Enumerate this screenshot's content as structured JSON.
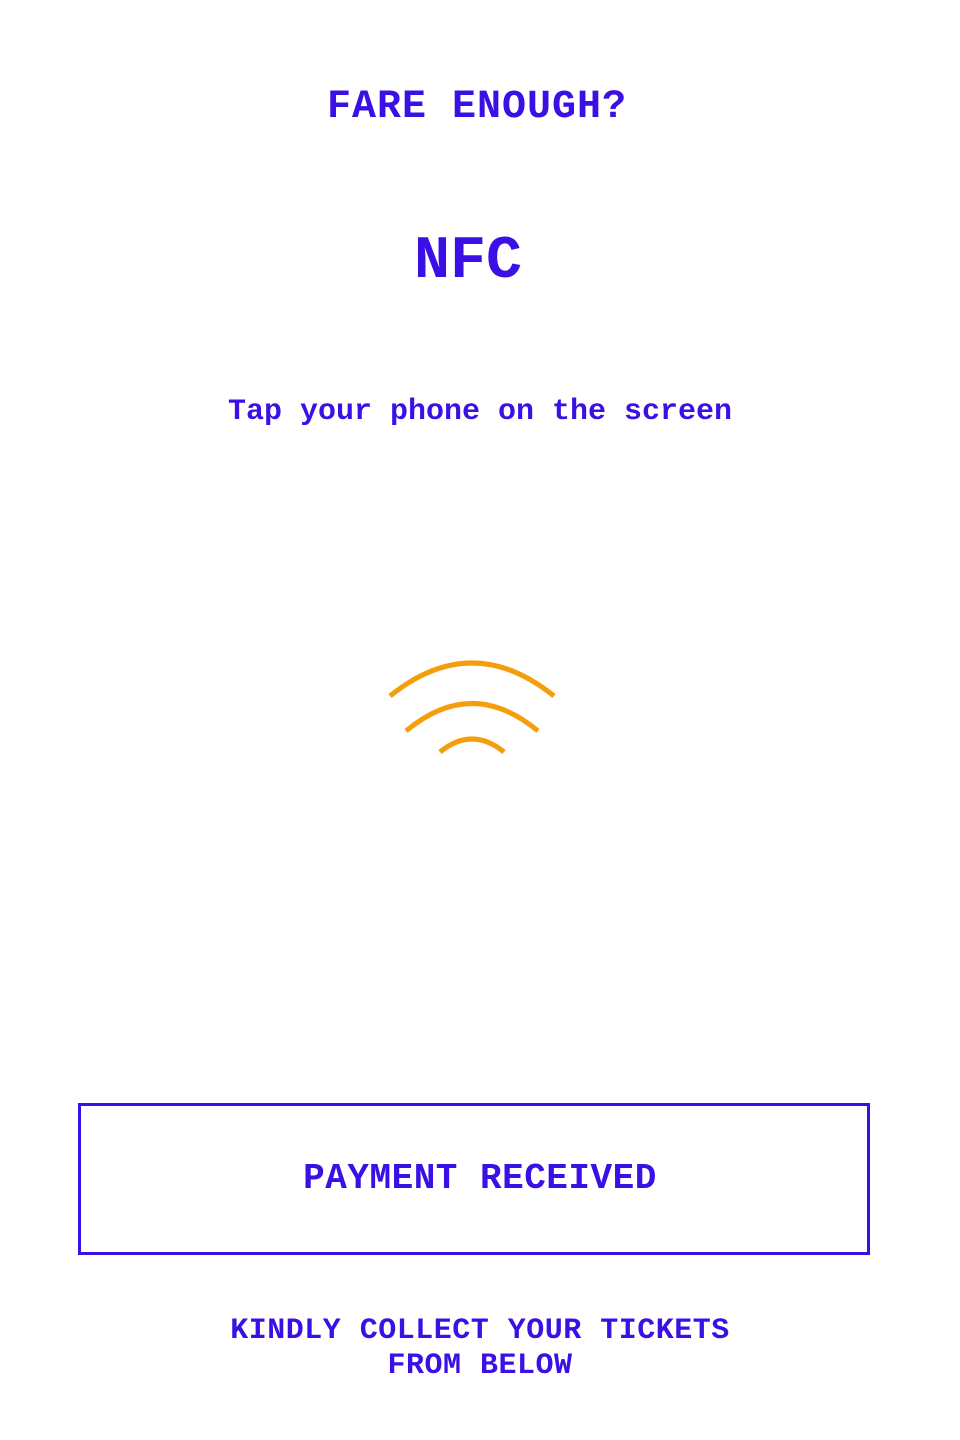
{
  "header": {
    "title": "FARE ENOUGH?"
  },
  "payment": {
    "method": "NFC",
    "instruction": "Tap your phone on the screen",
    "icon": "nfc-signal-icon",
    "icon_color": "#f59e0b"
  },
  "status": {
    "label": "PAYMENT RECEIVED"
  },
  "footer": {
    "line1": "KINDLY COLLECT YOUR TICKETS",
    "line2": "FROM BELOW"
  },
  "colors": {
    "primary": "#3a10e5",
    "accent": "#f59e0b",
    "background": "#ffffff"
  }
}
